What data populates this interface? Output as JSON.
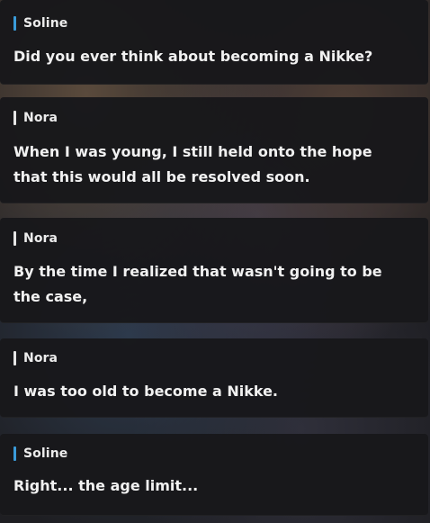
{
  "colors": {
    "soline_accent": "#3a9bd9",
    "nora_accent": "#e6e6e6",
    "panel_bg": "#18181b",
    "text": "#f1f1f1"
  },
  "entries": [
    {
      "speaker": "Soline",
      "text": "Did you ever think about becoming a Nikke?"
    },
    {
      "speaker": "Nora",
      "text": "When I was young, I still held onto the hope that this would all be resolved soon."
    },
    {
      "speaker": "Nora",
      "text": "By the time I realized that wasn't going to be the case,"
    },
    {
      "speaker": "Nora",
      "text": "I was too old to become a Nikke."
    },
    {
      "speaker": "Soline",
      "text": "Right... the age limit..."
    }
  ]
}
